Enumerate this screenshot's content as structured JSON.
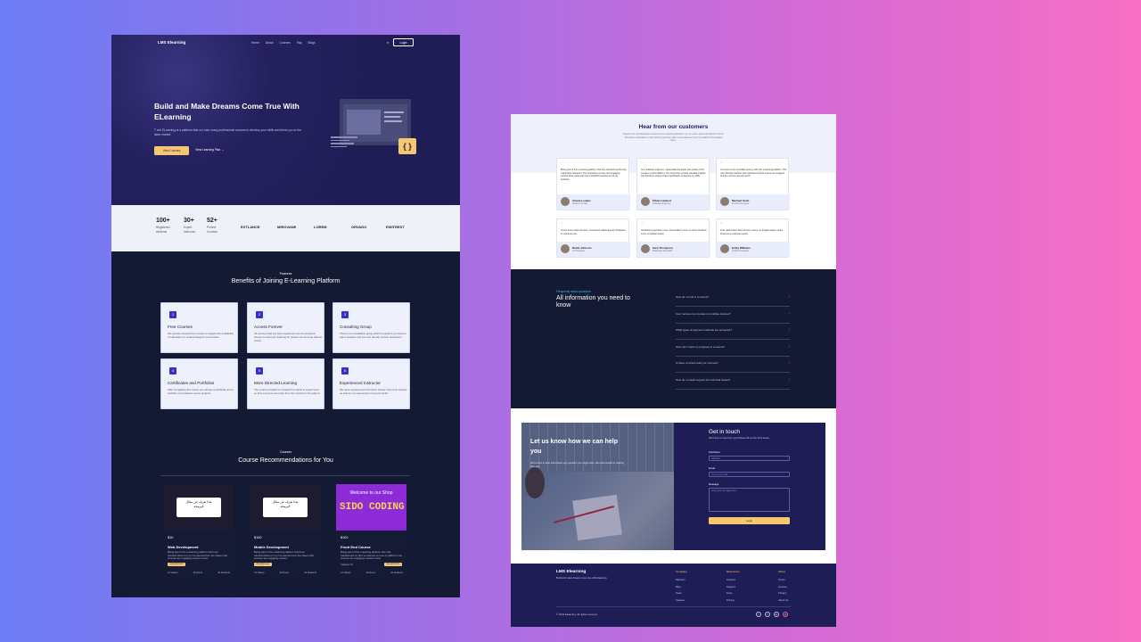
{
  "left": {
    "nav": {
      "logo": "LMS Elearning",
      "links": [
        "Home",
        "About",
        "Courses",
        "Faq",
        "Blogs"
      ],
      "search_icon": "search-icon",
      "login": "Login"
    },
    "hero": {
      "title": "Build and Make Dreams Come True With ELearning",
      "desc": "T sch ELearning is a platform that our tutor many professional courses to develop your skills and direct you to the labor market",
      "cta": "View Courses",
      "cta2": "View Learning Plan →",
      "code_glyph": "{ }"
    },
    "stats": [
      {
        "n": "100+",
        "l1": "Registered",
        "l2": "students"
      },
      {
        "n": "30+",
        "l1": "Expert",
        "l2": "Instructor"
      },
      {
        "n": "52+",
        "l1": "Perfect",
        "l2": "Courses"
      }
    ],
    "partners": [
      "EXTLANCE",
      "MIROVANE",
      "LOREM",
      "ORVADO",
      "EWITREST"
    ],
    "features": {
      "sub": "Features",
      "title": "Benefits of Joining E-Learning Platform",
      "items": [
        {
          "title": "Free Courses",
          "desc": "We provide several free courses to support the availability of education for underprivileged communities."
        },
        {
          "title": "Access Forever",
          "desc": "All courses that you have registered can be accessed forever so that your learning for review can be done without a limit."
        },
        {
          "title": "Consulting Group",
          "desc": "There is a consultation group which is useful if you want to ask a question and you can directly receive discussion."
        },
        {
          "title": "Certificates and Portfolios",
          "desc": "After completing the course you will get a certificate and a portfolio of completed course projects."
        },
        {
          "title": "More Directed Learning",
          "desc": "The course provided is created from basic to expert level so that everyone can learn from the scratch to the pattern."
        },
        {
          "title": "Experienced Instructor",
          "desc": "We have experienced instructors chosen from their interest as well as our experience in beyond doubt."
        }
      ]
    },
    "courses": {
      "sub": "Courses",
      "title": "Course Recommendations for You",
      "items": [
        {
          "price": "$10",
          "title": "Web Development",
          "desc": "Being part of the e-learning platform has been transformative for me I've learned from the videos that courses are engaging content mixes.",
          "tag": "Development",
          "meta": [
            "12 Videos",
            "20 Hours",
            "2k Students"
          ],
          "img": "arabic",
          "img_text1": "ماذا تعرف عن مجال",
          "img_text2": "البرمجة"
        },
        {
          "price": "$100",
          "title": "Mobile Development",
          "desc": "Being part of the e-learning platform has been transformative for me I've learned from the videos that courses are engaging content.",
          "tag": "Development",
          "meta": [
            "12 Videos",
            "20 Hours",
            "2k Students"
          ],
          "img": "arabic",
          "img_text1": "ماذا تعرف عن مجال",
          "img_text2": "البرمجة"
        },
        {
          "price": "$100",
          "title": "Front End Course",
          "desc": "Being part of this e-learning platform has truly transformed my life I've learned on a lot of platforms the courses are engaging content mixes.",
          "tag": "Development",
          "category": "Category IS",
          "meta": [
            "12 Videos",
            "20 Hours",
            "2k Students"
          ],
          "img": "purple",
          "img_text1": "Welcome to our Shop",
          "img_text2": "SIDO CODING"
        }
      ]
    }
  },
  "right": {
    "testimonials": {
      "title": "Hear from our customers",
      "sub": "Explore the transformative impact of our e-learning platform on our users. Hear directly from those who have embarked on their learning journey with us and discover how our platform has helped them.",
      "items": [
        {
          "text": "Being part of this e-learning platform has truly transformed the way I approach education. The interactive courses and engaging content have made learning a delightful experience for our students.",
          "name": "Ariana Loudes",
          "role": "Student at Yale"
        },
        {
          "text": "As a software engineer, I appreciate the depth and quality of the courses on this platform. The instructors provide valuable insights and hands-on projects have significantly enhanced my skills.",
          "name": "Ethan Lambert",
          "role": "Software Engineer"
        },
        {
          "text": "I've been on an incredible journey with this e-learning platform. The user-friendly interface and customized content keep me engaged, and the courses are top-notch.",
          "name": "Michael Scott",
          "role": "Product Designer"
        },
        {
          "text": "Lorem ipsum dolor sit amet, consectetur adipiscing elit. Phasellus in tincidunt justo.",
          "name": "David Johnson",
          "role": "UX Designer"
        },
        {
          "text": "Vestibulum eget libero risus. Duis eleifend, ante ut rutrum tincidunt, lorem mi facilisis lectus.",
          "name": "Sara Thompson",
          "role": "Marketing Specialist"
        },
        {
          "text": "Cras ullamcorper diam ac arcu cursus, ac fringilla sapien varius. Praesent ut vehicula mauris.",
          "name": "Emily Williams",
          "role": "Graphic Designer"
        }
      ]
    },
    "faq": {
      "sub": "Frequently asked questions",
      "title": "All information you need to know",
      "items": [
        "How do I enroll in a course?",
        "Can I access my courses on multiple devices?",
        "What types of payment methods are accepted?",
        "How can I track my progress in a course?",
        "Is there a refund policy for courses?",
        "How do I contact support for technical issues?"
      ]
    },
    "contact": {
      "left_title": "Let us know how we can help you",
      "left_desc": "We're here to help and answer any question you might have. We look forward to hearing from you.",
      "title": "Get in touch",
      "desc": "We'd love to hear from you! Please fill out the form below.",
      "fields": [
        {
          "label": "Full Name",
          "placeholder": "Aditi Sen"
        },
        {
          "label": "Email",
          "placeholder": "enter your email"
        },
        {
          "label": "Message",
          "placeholder": "enter your message here"
        }
      ],
      "button": "Login"
    },
    "footer": {
      "brand": "LMS Elearning",
      "desc": "Build and make dreams come true with Elearning",
      "cols": [
        {
          "h": "Company",
          "items": [
            "Partners",
            "Blog",
            "Team",
            "Careers"
          ]
        },
        {
          "h": "Resources",
          "items": [
            "Contact",
            "Support",
            "Docs",
            "Pricing"
          ]
        },
        {
          "h": "About",
          "items": [
            "Terms",
            "License",
            "Privacy",
            "About Us"
          ]
        }
      ],
      "copy": "© 2023 Elearning. All rights reserved.",
      "social": [
        "twitter-icon",
        "facebook-icon",
        "linkedin-icon",
        "instagram-icon"
      ]
    }
  }
}
